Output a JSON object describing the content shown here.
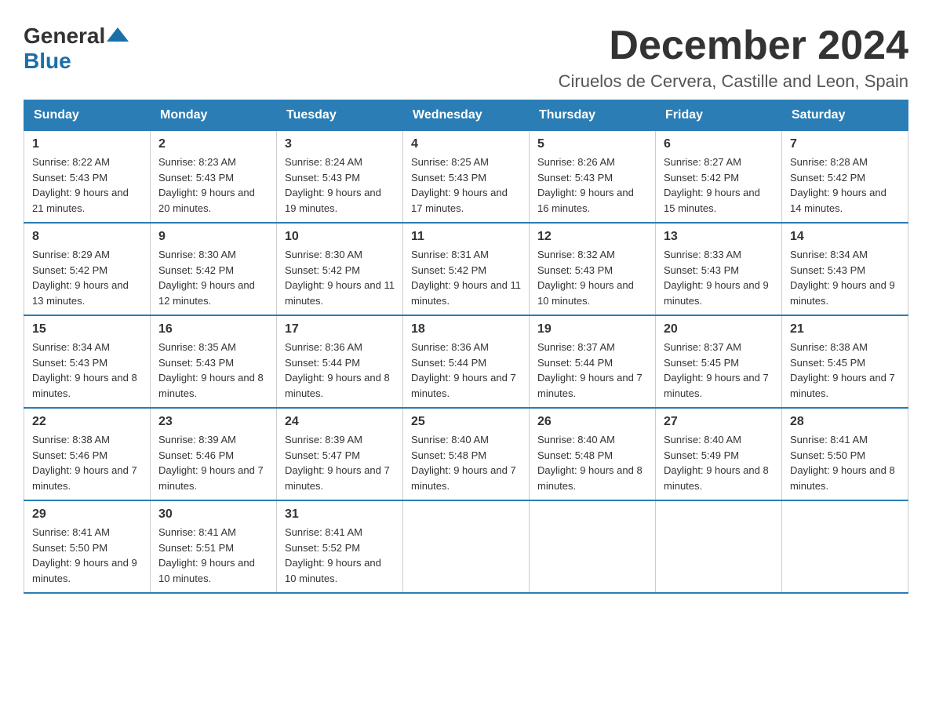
{
  "logo": {
    "general": "General",
    "blue": "Blue"
  },
  "title": "December 2024",
  "subtitle": "Ciruelos de Cervera, Castille and Leon, Spain",
  "weekdays": [
    "Sunday",
    "Monday",
    "Tuesday",
    "Wednesday",
    "Thursday",
    "Friday",
    "Saturday"
  ],
  "weeks": [
    [
      {
        "day": "1",
        "sunrise": "8:22 AM",
        "sunset": "5:43 PM",
        "daylight": "9 hours and 21 minutes."
      },
      {
        "day": "2",
        "sunrise": "8:23 AM",
        "sunset": "5:43 PM",
        "daylight": "9 hours and 20 minutes."
      },
      {
        "day": "3",
        "sunrise": "8:24 AM",
        "sunset": "5:43 PM",
        "daylight": "9 hours and 19 minutes."
      },
      {
        "day": "4",
        "sunrise": "8:25 AM",
        "sunset": "5:43 PM",
        "daylight": "9 hours and 17 minutes."
      },
      {
        "day": "5",
        "sunrise": "8:26 AM",
        "sunset": "5:43 PM",
        "daylight": "9 hours and 16 minutes."
      },
      {
        "day": "6",
        "sunrise": "8:27 AM",
        "sunset": "5:42 PM",
        "daylight": "9 hours and 15 minutes."
      },
      {
        "day": "7",
        "sunrise": "8:28 AM",
        "sunset": "5:42 PM",
        "daylight": "9 hours and 14 minutes."
      }
    ],
    [
      {
        "day": "8",
        "sunrise": "8:29 AM",
        "sunset": "5:42 PM",
        "daylight": "9 hours and 13 minutes."
      },
      {
        "day": "9",
        "sunrise": "8:30 AM",
        "sunset": "5:42 PM",
        "daylight": "9 hours and 12 minutes."
      },
      {
        "day": "10",
        "sunrise": "8:30 AM",
        "sunset": "5:42 PM",
        "daylight": "9 hours and 11 minutes."
      },
      {
        "day": "11",
        "sunrise": "8:31 AM",
        "sunset": "5:42 PM",
        "daylight": "9 hours and 11 minutes."
      },
      {
        "day": "12",
        "sunrise": "8:32 AM",
        "sunset": "5:43 PM",
        "daylight": "9 hours and 10 minutes."
      },
      {
        "day": "13",
        "sunrise": "8:33 AM",
        "sunset": "5:43 PM",
        "daylight": "9 hours and 9 minutes."
      },
      {
        "day": "14",
        "sunrise": "8:34 AM",
        "sunset": "5:43 PM",
        "daylight": "9 hours and 9 minutes."
      }
    ],
    [
      {
        "day": "15",
        "sunrise": "8:34 AM",
        "sunset": "5:43 PM",
        "daylight": "9 hours and 8 minutes."
      },
      {
        "day": "16",
        "sunrise": "8:35 AM",
        "sunset": "5:43 PM",
        "daylight": "9 hours and 8 minutes."
      },
      {
        "day": "17",
        "sunrise": "8:36 AM",
        "sunset": "5:44 PM",
        "daylight": "9 hours and 8 minutes."
      },
      {
        "day": "18",
        "sunrise": "8:36 AM",
        "sunset": "5:44 PM",
        "daylight": "9 hours and 7 minutes."
      },
      {
        "day": "19",
        "sunrise": "8:37 AM",
        "sunset": "5:44 PM",
        "daylight": "9 hours and 7 minutes."
      },
      {
        "day": "20",
        "sunrise": "8:37 AM",
        "sunset": "5:45 PM",
        "daylight": "9 hours and 7 minutes."
      },
      {
        "day": "21",
        "sunrise": "8:38 AM",
        "sunset": "5:45 PM",
        "daylight": "9 hours and 7 minutes."
      }
    ],
    [
      {
        "day": "22",
        "sunrise": "8:38 AM",
        "sunset": "5:46 PM",
        "daylight": "9 hours and 7 minutes."
      },
      {
        "day": "23",
        "sunrise": "8:39 AM",
        "sunset": "5:46 PM",
        "daylight": "9 hours and 7 minutes."
      },
      {
        "day": "24",
        "sunrise": "8:39 AM",
        "sunset": "5:47 PM",
        "daylight": "9 hours and 7 minutes."
      },
      {
        "day": "25",
        "sunrise": "8:40 AM",
        "sunset": "5:48 PM",
        "daylight": "9 hours and 7 minutes."
      },
      {
        "day": "26",
        "sunrise": "8:40 AM",
        "sunset": "5:48 PM",
        "daylight": "9 hours and 8 minutes."
      },
      {
        "day": "27",
        "sunrise": "8:40 AM",
        "sunset": "5:49 PM",
        "daylight": "9 hours and 8 minutes."
      },
      {
        "day": "28",
        "sunrise": "8:41 AM",
        "sunset": "5:50 PM",
        "daylight": "9 hours and 8 minutes."
      }
    ],
    [
      {
        "day": "29",
        "sunrise": "8:41 AM",
        "sunset": "5:50 PM",
        "daylight": "9 hours and 9 minutes."
      },
      {
        "day": "30",
        "sunrise": "8:41 AM",
        "sunset": "5:51 PM",
        "daylight": "9 hours and 10 minutes."
      },
      {
        "day": "31",
        "sunrise": "8:41 AM",
        "sunset": "5:52 PM",
        "daylight": "9 hours and 10 minutes."
      },
      null,
      null,
      null,
      null
    ]
  ]
}
